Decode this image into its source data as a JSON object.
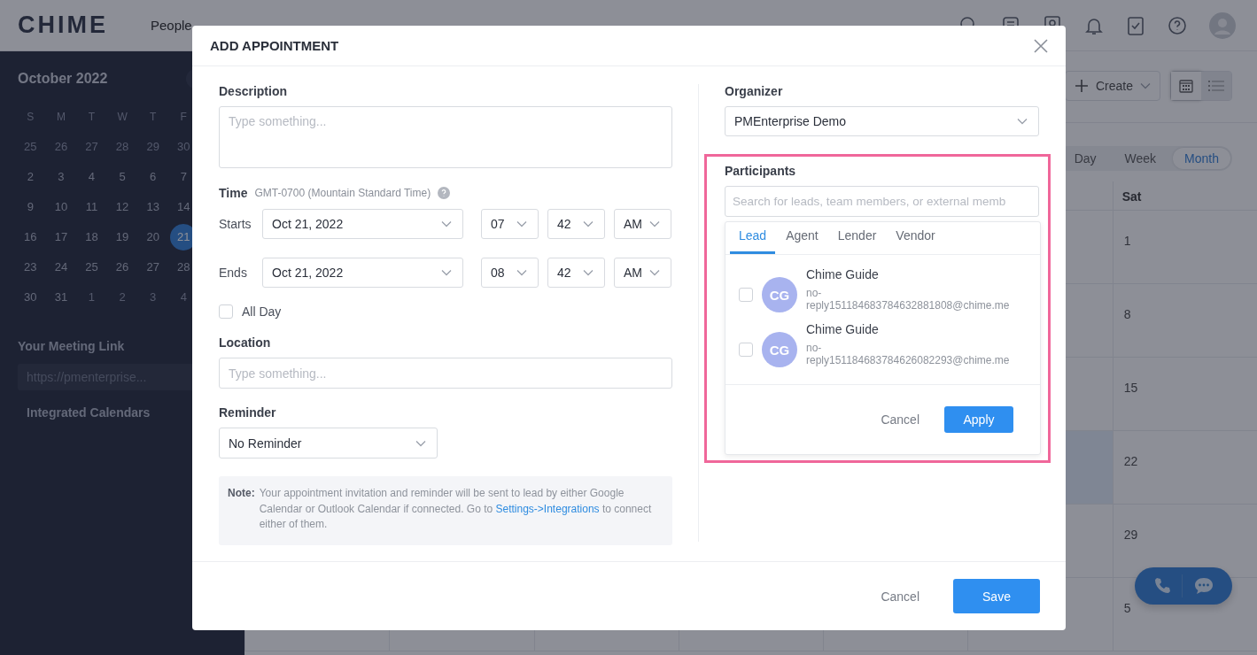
{
  "top_nav": {
    "logo": "CHIME",
    "items": [
      {
        "label": "People"
      }
    ]
  },
  "sidebar": {
    "month_title": "October 2022",
    "weekdays": [
      "S",
      "M",
      "T",
      "W",
      "T",
      "F"
    ],
    "weeks": [
      [
        {
          "day": "25",
          "in_month": false,
          "selected": false
        },
        {
          "day": "26",
          "in_month": false,
          "selected": false
        },
        {
          "day": "27",
          "in_month": false,
          "selected": false
        },
        {
          "day": "28",
          "in_month": false,
          "selected": false
        },
        {
          "day": "29",
          "in_month": false,
          "selected": false
        },
        {
          "day": "30",
          "in_month": false,
          "selected": false
        }
      ],
      [
        {
          "day": "2",
          "in_month": true,
          "selected": false
        },
        {
          "day": "3",
          "in_month": true,
          "selected": false
        },
        {
          "day": "4",
          "in_month": true,
          "selected": false
        },
        {
          "day": "5",
          "in_month": true,
          "selected": false
        },
        {
          "day": "6",
          "in_month": true,
          "selected": false
        },
        {
          "day": "7",
          "in_month": true,
          "selected": false
        }
      ],
      [
        {
          "day": "9",
          "in_month": true,
          "selected": false
        },
        {
          "day": "10",
          "in_month": true,
          "selected": false
        },
        {
          "day": "11",
          "in_month": true,
          "selected": false
        },
        {
          "day": "12",
          "in_month": true,
          "selected": false
        },
        {
          "day": "13",
          "in_month": true,
          "selected": false
        },
        {
          "day": "14",
          "in_month": true,
          "selected": false
        }
      ],
      [
        {
          "day": "16",
          "in_month": true,
          "selected": false
        },
        {
          "day": "17",
          "in_month": true,
          "selected": false
        },
        {
          "day": "18",
          "in_month": true,
          "selected": false
        },
        {
          "day": "19",
          "in_month": true,
          "selected": false
        },
        {
          "day": "20",
          "in_month": true,
          "selected": false
        },
        {
          "day": "21",
          "in_month": true,
          "selected": true
        }
      ],
      [
        {
          "day": "23",
          "in_month": true,
          "selected": false
        },
        {
          "day": "24",
          "in_month": true,
          "selected": false
        },
        {
          "day": "25",
          "in_month": true,
          "selected": false
        },
        {
          "day": "26",
          "in_month": true,
          "selected": false
        },
        {
          "day": "27",
          "in_month": true,
          "selected": false
        },
        {
          "day": "28",
          "in_month": true,
          "selected": false
        }
      ],
      [
        {
          "day": "30",
          "in_month": true,
          "selected": false
        },
        {
          "day": "31",
          "in_month": true,
          "selected": false
        },
        {
          "day": "1",
          "in_month": false,
          "selected": false
        },
        {
          "day": "2",
          "in_month": false,
          "selected": false
        },
        {
          "day": "3",
          "in_month": false,
          "selected": false
        },
        {
          "day": "4",
          "in_month": false,
          "selected": false
        }
      ]
    ],
    "meeting_link": {
      "title": "Your Meeting Link",
      "url": "https://pmenterprise..."
    },
    "integrated_calendars": "Integrated Calendars"
  },
  "calendar": {
    "create_button": "Create",
    "view_toggles": [
      {
        "kind": "grid",
        "selected": true
      },
      {
        "kind": "list",
        "selected": false
      }
    ],
    "view_tabs": [
      {
        "label": "Day",
        "selected": false
      },
      {
        "label": "Week",
        "selected": false
      },
      {
        "label": "Month",
        "selected": true
      }
    ],
    "column_header": "Sat",
    "weeks": [
      {
        "saturday": "1",
        "friday_highlighted": false
      },
      {
        "saturday": "8",
        "friday_highlighted": false
      },
      {
        "saturday": "15",
        "friday_highlighted": false
      },
      {
        "saturday": "22",
        "friday_highlighted": true
      },
      {
        "saturday": "29",
        "friday_highlighted": false
      },
      {
        "saturday": "5",
        "friday_highlighted": false
      }
    ]
  },
  "modal": {
    "title": "ADD APPOINTMENT",
    "description": {
      "label": "Description",
      "placeholder": "Type something..."
    },
    "time": {
      "label": "Time",
      "timezone": "GMT-0700 (Mountain Standard Time)"
    },
    "time_rows": [
      {
        "label": "Starts",
        "date": "Oct 21, 2022",
        "hour": "07",
        "minute": "42",
        "period": "AM"
      },
      {
        "label": "Ends",
        "date": "Oct 21, 2022",
        "hour": "08",
        "minute": "42",
        "period": "AM"
      }
    ],
    "all_day": {
      "label": "All Day",
      "checked": false
    },
    "location": {
      "label": "Location",
      "placeholder": "Type something..."
    },
    "reminder": {
      "label": "Reminder",
      "value": "No Reminder"
    },
    "note": {
      "label": "Note:",
      "text_before": "Your appointment invitation and reminder will be sent to lead by either Google Calendar or Outlook Calendar if connected. Go to",
      "link": "Settings->Integrations",
      "text_after": "to connect either of them."
    },
    "organizer": {
      "label": "Organizer",
      "value": "PMEnterprise Demo"
    },
    "participants": {
      "label": "Participants",
      "placeholder": "Search for leads, team members, or external memb",
      "tabs": [
        {
          "label": "Lead",
          "selected": true
        },
        {
          "label": "Agent",
          "selected": false
        },
        {
          "label": "Lender",
          "selected": false
        },
        {
          "label": "Vendor",
          "selected": false
        }
      ],
      "people": [
        {
          "initials": "CG",
          "name": "Chime Guide",
          "email": "no-reply151184683784632881808@chime.me",
          "checked": false
        },
        {
          "initials": "CG",
          "name": "Chime Guide",
          "email": "no-reply151184683784626082293@chime.me",
          "checked": false
        }
      ],
      "cancel": "Cancel",
      "apply": "Apply"
    },
    "cancel": "Cancel",
    "save": "Save"
  }
}
